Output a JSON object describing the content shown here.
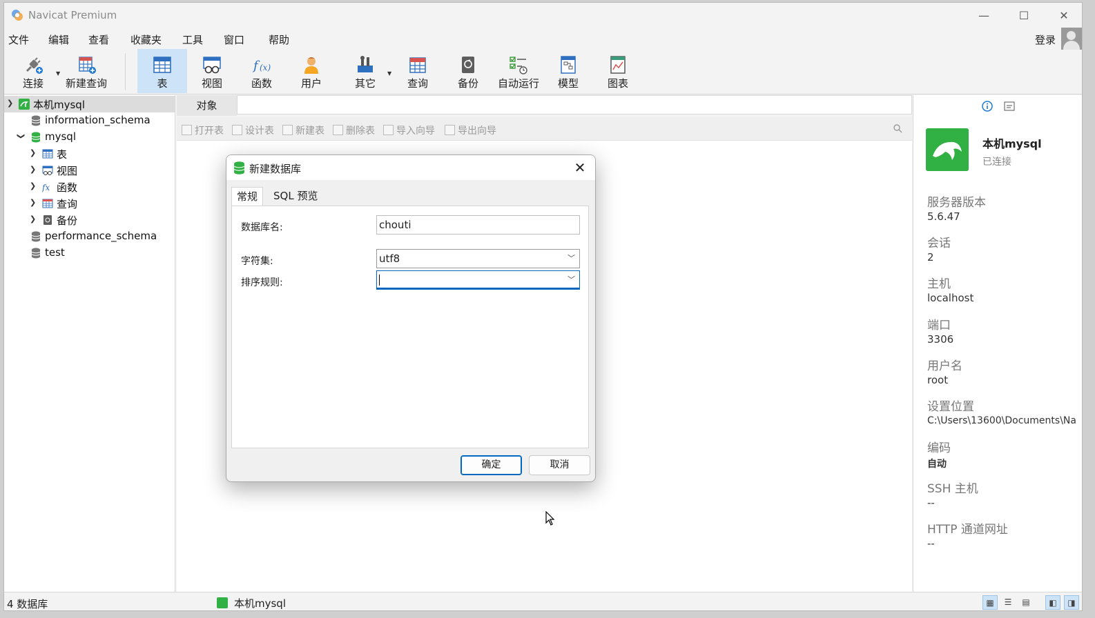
{
  "window": {
    "title": "Navicat Premium",
    "minimize": "—",
    "maximize": "☐",
    "close": "✕"
  },
  "menu": {
    "items": [
      "文件",
      "编辑",
      "查看",
      "收藏夹",
      "工具",
      "窗口",
      "帮助"
    ],
    "login": "登录"
  },
  "toolbar": {
    "buttons": [
      "连接",
      "新建查询",
      "表",
      "视图",
      "函数",
      "用户",
      "其它",
      "查询",
      "备份",
      "自动运行",
      "模型",
      "图表"
    ],
    "active": "表"
  },
  "tree": {
    "connection": "本机mysql",
    "databases": [
      "information_schema",
      "mysql",
      "performance_schema",
      "test"
    ],
    "mysql_children": [
      "表",
      "视图",
      "函数",
      "查询",
      "备份"
    ]
  },
  "center": {
    "tab": "对象",
    "actions": [
      "打开表",
      "设计表",
      "新建表",
      "删除表",
      "导入向导",
      "导出向导"
    ]
  },
  "info": {
    "name": "本机mysql",
    "status": "已连接",
    "fields": [
      {
        "label": "服务器版本",
        "value": "5.6.47"
      },
      {
        "label": "会话",
        "value": "2"
      },
      {
        "label": "主机",
        "value": "localhost"
      },
      {
        "label": "端口",
        "value": "3306"
      },
      {
        "label": "用户名",
        "value": "root"
      },
      {
        "label": "设置位置",
        "value": "C:\\Users\\13600\\Documents\\Na"
      },
      {
        "label": "编码",
        "value": "自动"
      },
      {
        "label": "SSH 主机",
        "value": "--"
      },
      {
        "label": "HTTP 通道网址",
        "value": "--"
      }
    ]
  },
  "status": {
    "left": "4 数据库",
    "connection": "本机mysql"
  },
  "dialog": {
    "title": "新建数据库",
    "tabs": [
      "常规",
      "SQL 预览"
    ],
    "db_name_label": "数据库名:",
    "db_name_value": "chouti",
    "charset_label": "字符集:",
    "charset_value": "utf8",
    "collation_label": "排序规则:",
    "collation_value": "",
    "ok": "确定",
    "cancel": "取消"
  },
  "colors": {
    "accent": "#0067c0",
    "mysql_green": "#31b044",
    "active_toolbar": "#cde3f7"
  }
}
